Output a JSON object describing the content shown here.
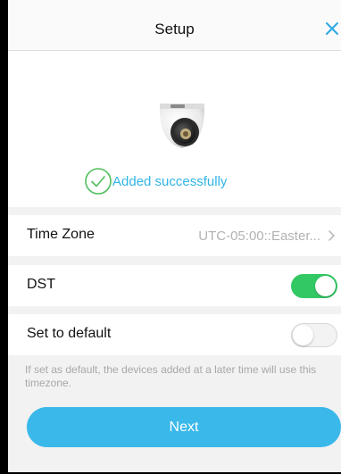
{
  "header": {
    "title": "Setup",
    "close_icon": "close-x-icon"
  },
  "device": {
    "image": "dome-camera-illustration",
    "status_icon": "check-circle-icon",
    "status_text": "Added successfully"
  },
  "settings": {
    "time_zone": {
      "label": "Time Zone",
      "value": "UTC-05:00::Easter...",
      "icon": "chevron-right-icon"
    },
    "dst": {
      "label": "DST",
      "enabled": true
    },
    "default": {
      "label": "Set to default",
      "enabled": false
    },
    "hint": "If set as default, the devices added at a later time will use this timezone."
  },
  "actions": {
    "next_label": "Next"
  },
  "colors": {
    "accent": "#3ab8ea",
    "toggle_on": "#32c864",
    "success": "#2fb5e5"
  }
}
